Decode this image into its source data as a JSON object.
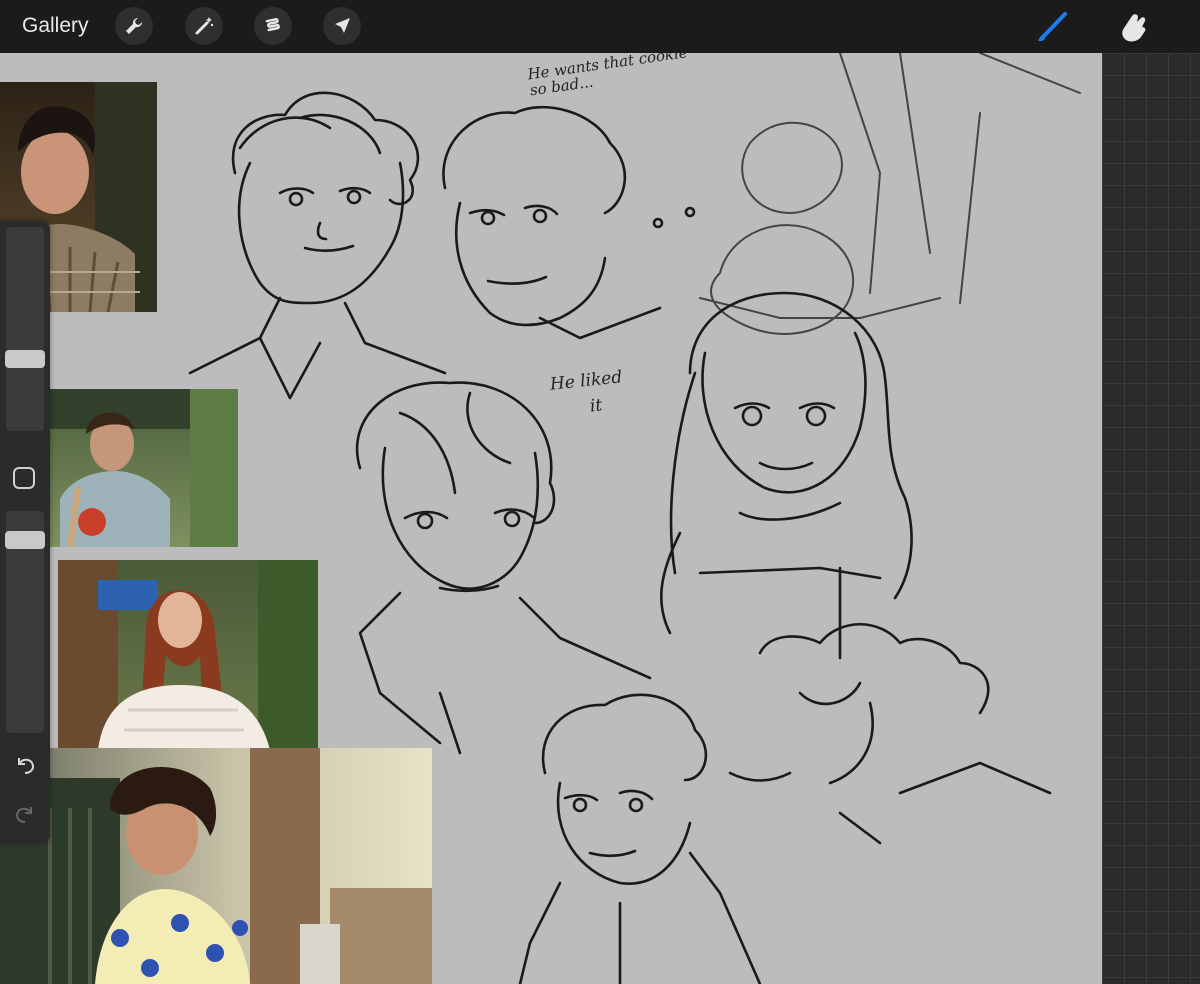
{
  "topbar": {
    "gallery_label": "Gallery",
    "tools": [
      "wrench-icon",
      "magic-wand-icon",
      "selection-icon",
      "transform-arrow-icon"
    ],
    "right_tools": [
      "brush-icon",
      "smudge-icon"
    ],
    "active_tool_color": "#1e7cf2"
  },
  "canvas": {
    "background_color": "#bcbcbc",
    "notes": {
      "note_top": "He wants that cookie so bad...",
      "note_liked_line1": "He liked",
      "note_liked_line2": "it"
    },
    "reference_photos": [
      {
        "label": "curly-haired young man, plaid shirt, restaurant"
      },
      {
        "label": "young man with backpack, outdoors"
      },
      {
        "label": "red-haired young woman, white lace top"
      },
      {
        "label": "curly-haired young man, floral shirt"
      }
    ]
  },
  "sidebar_left": {
    "controls": [
      "brush-size-slider",
      "modify-button",
      "opacity-slider",
      "undo-icon",
      "redo-icon"
    ]
  }
}
